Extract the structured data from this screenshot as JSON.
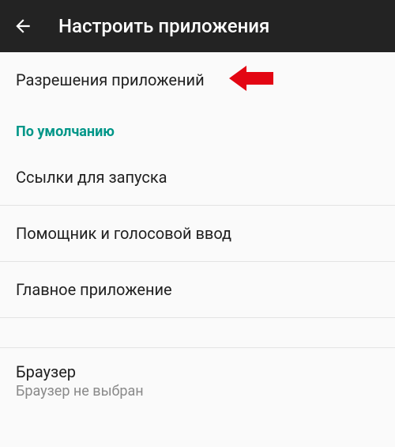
{
  "header": {
    "title": "Настроить приложения"
  },
  "items": {
    "app_permissions": "Разрешения приложений",
    "launch_links": "Ссылки для запуска",
    "assistant_voice": "Помощник и голосовой ввод",
    "main_app": "Главное приложение",
    "browser": {
      "title": "Браузер",
      "subtitle": "Браузер не выбран"
    }
  },
  "sections": {
    "default": "По умолчанию"
  },
  "colors": {
    "header_bg": "#232323",
    "accent": "#009688",
    "arrow": "#e30613"
  }
}
